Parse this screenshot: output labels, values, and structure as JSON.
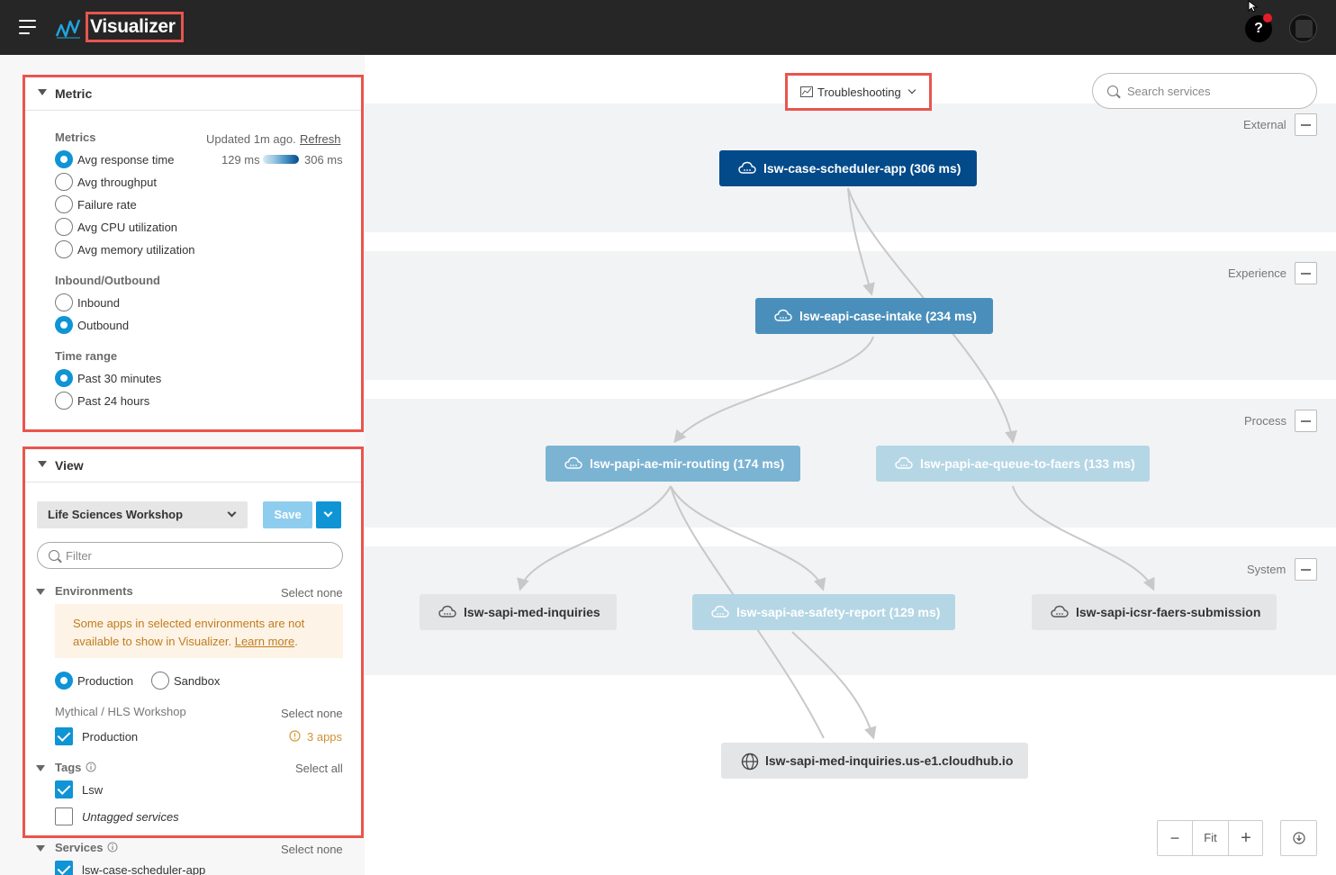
{
  "header": {
    "title": "Visualizer",
    "help": "?"
  },
  "metric": {
    "title": "Metric",
    "metrics_heading": "Metrics",
    "updated": "Updated 1m ago.",
    "refresh": "Refresh",
    "legend_min": "129 ms",
    "legend_max": "306 ms",
    "options": [
      "Avg response time",
      "Avg throughput",
      "Failure rate",
      "Avg CPU utilization",
      "Avg memory utilization"
    ],
    "selected_metric": "Avg response time",
    "direction_heading": "Inbound/Outbound",
    "direction_options": [
      "Inbound",
      "Outbound"
    ],
    "selected_direction": "Outbound",
    "time_heading": "Time range",
    "time_options": [
      "Past 30 minutes",
      "Past 24 hours"
    ],
    "selected_time": "Past 30 minutes"
  },
  "view": {
    "title": "View",
    "selected_view": "Life Sciences Workshop",
    "save_label": "Save",
    "filter_placeholder": "Filter",
    "environments_heading": "Environments",
    "environments_select_none": "Select none",
    "warning_text": "Some apps in selected environments are not available to show in Visualizer.",
    "warning_link": "Learn more",
    "env_options": [
      "Production",
      "Sandbox"
    ],
    "selected_env": "Production",
    "org_name": "Mythical / HLS Workshop",
    "org_select_none": "Select none",
    "org_env": "Production",
    "org_env_apps": "3 apps",
    "tags_heading": "Tags",
    "tags_select_all": "Select all",
    "tags": [
      {
        "label": "Lsw",
        "checked": true
      },
      {
        "label": "Untagged services",
        "checked": false
      }
    ],
    "services_heading": "Services",
    "services_select_none": "Select none",
    "services": [
      {
        "label": "lsw-case-scheduler-app",
        "checked": true
      }
    ]
  },
  "canvas": {
    "view_mode": "Troubleshooting",
    "search_placeholder": "Search services",
    "layers": [
      "External",
      "Experience",
      "Process",
      "System"
    ],
    "nodes": [
      {
        "id": "n1",
        "label": "lsw-case-scheduler-app (306 ms)",
        "color": "#034a8a",
        "icon": "cloud-icon"
      },
      {
        "id": "n2",
        "label": "lsw-eapi-case-intake (234 ms)",
        "color": "#4a8fbb",
        "icon": "cloud-icon"
      },
      {
        "id": "n3",
        "label": "lsw-papi-ae-mir-routing (174 ms)",
        "color": "#7bb3d3",
        "icon": "cloud-icon"
      },
      {
        "id": "n4",
        "label": "lsw-papi-ae-queue-to-faers (133 ms)",
        "color": "#b5d6e5",
        "icon": "cloud-icon"
      },
      {
        "id": "n5",
        "label": "lsw-sapi-med-inquiries",
        "color": "#e4e5e6",
        "icon": "cloud-icon"
      },
      {
        "id": "n6",
        "label": "lsw-sapi-ae-safety-report (129 ms)",
        "color": "#b5d6e5",
        "icon": "cloud-icon"
      },
      {
        "id": "n7",
        "label": "lsw-sapi-icsr-faers-submission",
        "color": "#e4e5e6",
        "icon": "cloud-icon"
      },
      {
        "id": "n8",
        "label": "lsw-sapi-med-inquiries.us-e1.cloudhub.io",
        "color": "#e4e5e6",
        "icon": "globe-icon"
      }
    ]
  },
  "zoom": {
    "fit_label": "Fit",
    "minus": "−",
    "plus": "+"
  }
}
